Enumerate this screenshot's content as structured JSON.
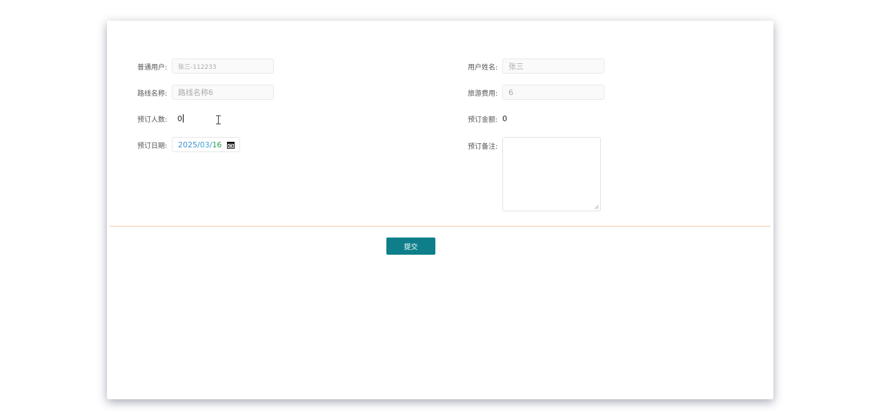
{
  "form": {
    "user": {
      "label": "普通用户:",
      "value": "张三-112233"
    },
    "user_name": {
      "label": "用户姓名:",
      "value": "张三"
    },
    "route_name": {
      "label": "路线名称:",
      "value": "路线名称6"
    },
    "travel_cost": {
      "label": "旅游费用:",
      "value": "6"
    },
    "people_count": {
      "label": "预订人数:",
      "value": "0"
    },
    "amount": {
      "label": "预订金额:",
      "value": "0"
    },
    "date": {
      "label": "预订日期:",
      "year": "2025",
      "sep1": "/",
      "month": "03",
      "sep2": "/",
      "day": "16",
      "icon": "calendar-icon"
    },
    "remarks": {
      "label": "预订备注:",
      "value": ""
    }
  },
  "actions": {
    "submit_label": "提交"
  },
  "colors": {
    "submit_bg": "#0e7f8a",
    "divider": "#f3c9a5",
    "date_year": "#3b8ed8",
    "date_month": "#3aa7c9",
    "date_day": "#2ba04c"
  }
}
